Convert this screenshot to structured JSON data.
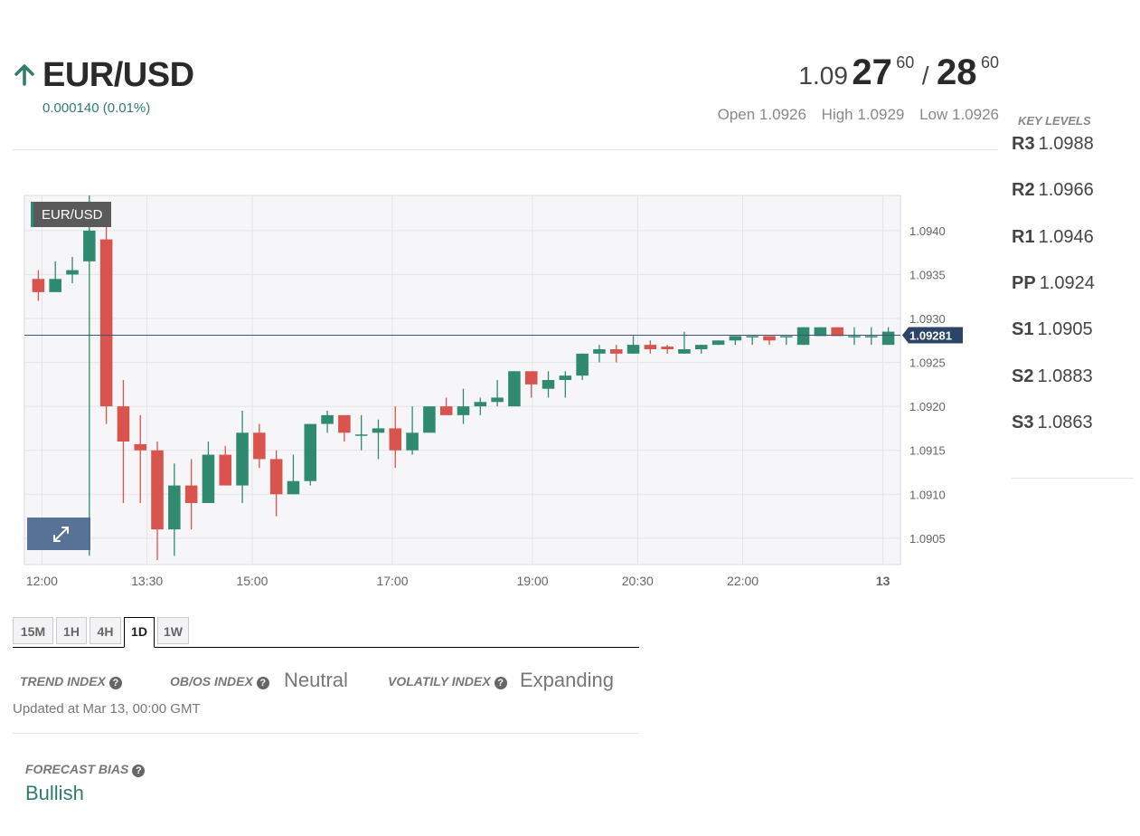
{
  "instrument": {
    "name": "EUR/USD",
    "direction_icon": "arrow-up-icon",
    "change": "0.000140 (0.01%)"
  },
  "quote": {
    "bid_prefix": "1.09",
    "bid_big": "27",
    "bid_sup": "60",
    "separator": "/",
    "ask_big": "28",
    "ask_sup": "60",
    "open": "Open 1.0926",
    "high": "High 1.0929",
    "low": "Low 1.0926"
  },
  "key_levels": {
    "title": "KEY LEVELS",
    "levels": [
      {
        "name": "R3",
        "value": "1.0988"
      },
      {
        "name": "R2",
        "value": "1.0966"
      },
      {
        "name": "R1",
        "value": "1.0946"
      },
      {
        "name": "PP",
        "value": "1.0924"
      },
      {
        "name": "S1",
        "value": "1.0905"
      },
      {
        "name": "S2",
        "value": "1.0883"
      },
      {
        "name": "S3",
        "value": "1.0863"
      }
    ]
  },
  "chart_data": {
    "type": "candlestick",
    "legend": "EUR/USD",
    "current_price_label": "1.09281",
    "current_price": 1.09281,
    "ylim": [
      1.0902,
      1.0944
    ],
    "y_ticks": [
      "1.0940",
      "1.0935",
      "1.0930",
      "1.0925",
      "1.0920",
      "1.0915",
      "1.0910",
      "1.0905"
    ],
    "y_tick_values": [
      1.094,
      1.0935,
      1.093,
      1.0925,
      1.092,
      1.0915,
      1.091,
      1.0905
    ],
    "x_ticks": [
      "12:00",
      "13:30",
      "15:00",
      "17:00",
      "19:00",
      "20:30",
      "22:00",
      "13"
    ],
    "grid": true,
    "colors": {
      "up": "#2f8a70",
      "down": "#d9534f",
      "price_line": "#3d5478",
      "price_tag": "#2c4467",
      "grid": "#e3e3e8",
      "plot_bg": "#f6f6f8"
    },
    "candles": [
      {
        "o": 1.09345,
        "h": 1.09355,
        "l": 1.0932,
        "c": 1.0933
      },
      {
        "o": 1.0933,
        "h": 1.09365,
        "l": 1.0933,
        "c": 1.09345
      },
      {
        "o": 1.0935,
        "h": 1.0937,
        "l": 1.0934,
        "c": 1.09355
      },
      {
        "o": 1.09365,
        "h": 1.0944,
        "l": 1.0903,
        "c": 1.094
      },
      {
        "o": 1.0939,
        "h": 1.0942,
        "l": 1.0918,
        "c": 1.092
      },
      {
        "o": 1.092,
        "h": 1.0923,
        "l": 1.0909,
        "c": 1.0916
      },
      {
        "o": 1.09157,
        "h": 1.0919,
        "l": 1.0909,
        "c": 1.0915
      },
      {
        "o": 1.0915,
        "h": 1.0916,
        "l": 1.09025,
        "c": 1.0906
      },
      {
        "o": 1.0906,
        "h": 1.09135,
        "l": 1.0903,
        "c": 1.0911
      },
      {
        "o": 1.0911,
        "h": 1.0914,
        "l": 1.0906,
        "c": 1.0909
      },
      {
        "o": 1.0909,
        "h": 1.0916,
        "l": 1.0909,
        "c": 1.09145
      },
      {
        "o": 1.09145,
        "h": 1.09155,
        "l": 1.0911,
        "c": 1.0911
      },
      {
        "o": 1.0911,
        "h": 1.09195,
        "l": 1.0909,
        "c": 1.0917
      },
      {
        "o": 1.0917,
        "h": 1.0918,
        "l": 1.0913,
        "c": 1.0914
      },
      {
        "o": 1.0914,
        "h": 1.0915,
        "l": 1.09075,
        "c": 1.091
      },
      {
        "o": 1.091,
        "h": 1.09145,
        "l": 1.091,
        "c": 1.09115
      },
      {
        "o": 1.09115,
        "h": 1.0918,
        "l": 1.0911,
        "c": 1.0918
      },
      {
        "o": 1.0918,
        "h": 1.09195,
        "l": 1.0917,
        "c": 1.0919
      },
      {
        "o": 1.0919,
        "h": 1.0919,
        "l": 1.0916,
        "c": 1.0917
      },
      {
        "o": 1.09168,
        "h": 1.0919,
        "l": 1.0915,
        "c": 1.09168
      },
      {
        "o": 1.0917,
        "h": 1.09185,
        "l": 1.0914,
        "c": 1.09175
      },
      {
        "o": 1.09175,
        "h": 1.092,
        "l": 1.0913,
        "c": 1.0915
      },
      {
        "o": 1.0915,
        "h": 1.092,
        "l": 1.09145,
        "c": 1.0917
      },
      {
        "o": 1.0917,
        "h": 1.092,
        "l": 1.0917,
        "c": 1.092
      },
      {
        "o": 1.092,
        "h": 1.0921,
        "l": 1.0919,
        "c": 1.0919
      },
      {
        "o": 1.0919,
        "h": 1.0922,
        "l": 1.0918,
        "c": 1.092
      },
      {
        "o": 1.092,
        "h": 1.0921,
        "l": 1.0919,
        "c": 1.09205
      },
      {
        "o": 1.09205,
        "h": 1.0923,
        "l": 1.092,
        "c": 1.0921
      },
      {
        "o": 1.092,
        "h": 1.0924,
        "l": 1.092,
        "c": 1.0924
      },
      {
        "o": 1.0924,
        "h": 1.0924,
        "l": 1.0921,
        "c": 1.09225
      },
      {
        "o": 1.0922,
        "h": 1.0924,
        "l": 1.0921,
        "c": 1.0923
      },
      {
        "o": 1.0923,
        "h": 1.0924,
        "l": 1.0921,
        "c": 1.09235
      },
      {
        "o": 1.09235,
        "h": 1.0926,
        "l": 1.0923,
        "c": 1.0926
      },
      {
        "o": 1.0926,
        "h": 1.0927,
        "l": 1.0925,
        "c": 1.09265
      },
      {
        "o": 1.09265,
        "h": 1.0927,
        "l": 1.0925,
        "c": 1.0926
      },
      {
        "o": 1.0926,
        "h": 1.0928,
        "l": 1.0926,
        "c": 1.0927
      },
      {
        "o": 1.0927,
        "h": 1.09275,
        "l": 1.0926,
        "c": 1.09265
      },
      {
        "o": 1.09268,
        "h": 1.0927,
        "l": 1.0926,
        "c": 1.09265
      },
      {
        "o": 1.0926,
        "h": 1.09285,
        "l": 1.0926,
        "c": 1.09265
      },
      {
        "o": 1.09265,
        "h": 1.0927,
        "l": 1.0926,
        "c": 1.0927
      },
      {
        "o": 1.0927,
        "h": 1.09275,
        "l": 1.0927,
        "c": 1.09275
      },
      {
        "o": 1.09275,
        "h": 1.0928,
        "l": 1.0927,
        "c": 1.0928
      },
      {
        "o": 1.0928,
        "h": 1.0928,
        "l": 1.0927,
        "c": 1.0928
      },
      {
        "o": 1.0928,
        "h": 1.0928,
        "l": 1.0927,
        "c": 1.09275
      },
      {
        "o": 1.0928,
        "h": 1.0928,
        "l": 1.0927,
        "c": 1.0928
      },
      {
        "o": 1.0927,
        "h": 1.0929,
        "l": 1.0927,
        "c": 1.0929
      },
      {
        "o": 1.0928,
        "h": 1.0929,
        "l": 1.0928,
        "c": 1.0929
      },
      {
        "o": 1.0929,
        "h": 1.0929,
        "l": 1.0928,
        "c": 1.0928
      },
      {
        "o": 1.0928,
        "h": 1.0929,
        "l": 1.0927,
        "c": 1.0928
      },
      {
        "o": 1.0928,
        "h": 1.0929,
        "l": 1.0927,
        "c": 1.0928
      },
      {
        "o": 1.0927,
        "h": 1.0929,
        "l": 1.0927,
        "c": 1.09285
      }
    ]
  },
  "timeframes": {
    "items": [
      "15M",
      "1H",
      "4H",
      "1D",
      "1W"
    ],
    "active": "1D"
  },
  "indices": {
    "trend_label": "TREND INDEX",
    "trend_value": "",
    "obos_label": "OB/OS INDEX",
    "obos_value": "Neutral",
    "volatility_label": "VOLATILY INDEX",
    "volatility_value": "Expanding",
    "updated": "Updated at Mar 13, 00:00 GMT",
    "help_icon": "question-circle-icon"
  },
  "forecast": {
    "label": "FORECAST BIAS",
    "value": "Bullish"
  }
}
